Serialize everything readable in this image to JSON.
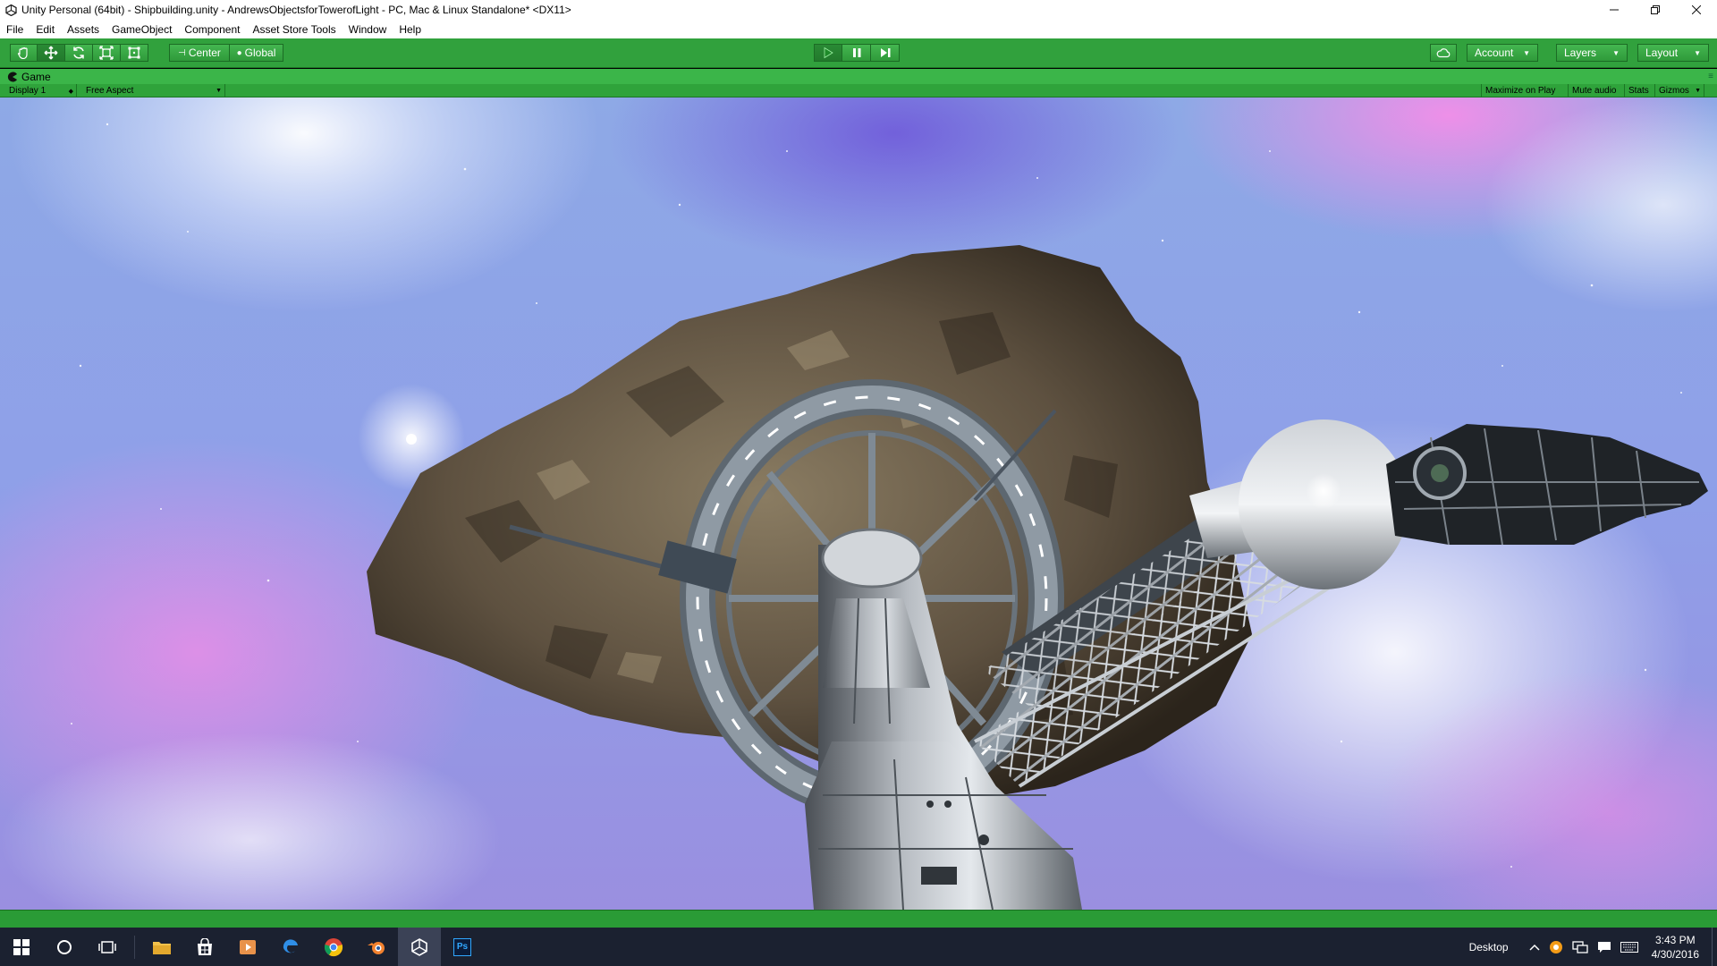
{
  "window": {
    "title": "Unity Personal (64bit) - Shipbuilding.unity - AndrewsObjectsforTowerofLight - PC, Mac & Linux Standalone* <DX11>"
  },
  "menu": [
    "File",
    "Edit",
    "Assets",
    "GameObject",
    "Component",
    "Asset Store Tools",
    "Window",
    "Help"
  ],
  "toolbar": {
    "transform_tools": [
      "hand-icon",
      "move-icon",
      "rotate-icon",
      "scale-icon",
      "rect-icon"
    ],
    "pivot_label": "Center",
    "space_label": "Global",
    "play_controls": [
      "play-icon",
      "pause-icon",
      "step-icon"
    ],
    "account_label": "Account",
    "layers_label": "Layers",
    "layout_label": "Layout"
  },
  "game_tab": {
    "label": "Game",
    "display_label": "Display 1",
    "aspect_label": "Free Aspect",
    "maximize_label": "Maximize on Play",
    "mute_label": "Mute audio",
    "stats_label": "Stats",
    "gizmos_label": "Gizmos"
  },
  "taskbar": {
    "apps": [
      "start-icon",
      "search-circle-icon",
      "task-view-icon",
      "file-explorer-icon",
      "store-icon",
      "media-player-icon",
      "edge-icon",
      "chrome-icon",
      "blender-icon",
      "unity-icon",
      "photoshop-icon"
    ],
    "desktop_label": "Desktop",
    "time": "3:43 PM",
    "date": "4/30/2016",
    "photoshop_text": "Ps"
  },
  "colors": {
    "unity_green": "#31a13d",
    "taskbar": "#1b2130"
  }
}
